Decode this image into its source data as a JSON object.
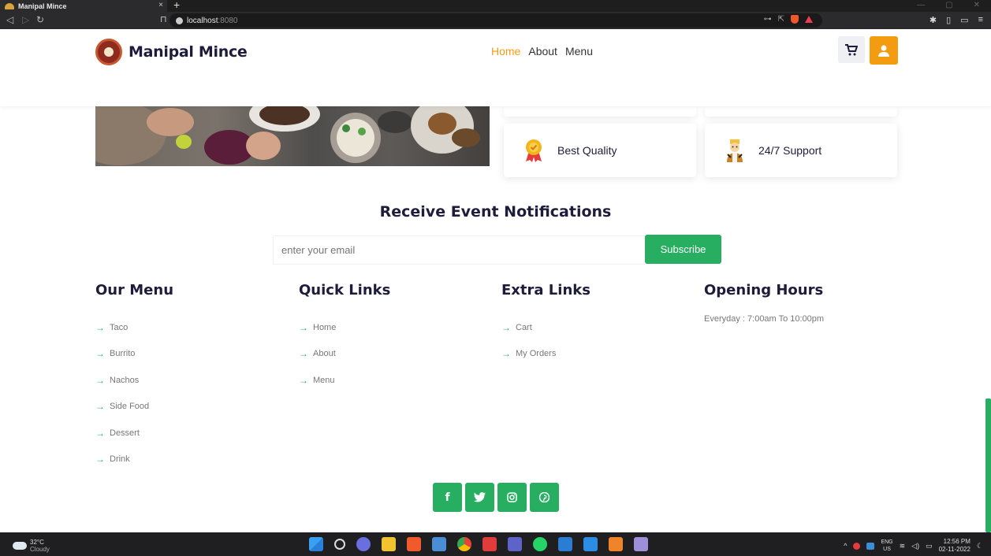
{
  "browser": {
    "tab_title": "Manipal Mince",
    "tab_close": "×",
    "new_tab": "+",
    "url_host": "localhost",
    "url_port": ":8080",
    "win_min": "—",
    "win_max": "▢",
    "win_close": "✕"
  },
  "header": {
    "logo_text": "Manipal Mince",
    "nav": [
      {
        "label": "Home"
      },
      {
        "label": "About"
      },
      {
        "label": "Menu"
      }
    ]
  },
  "features": [
    {
      "label": "Best Quality",
      "icon": "medal-icon"
    },
    {
      "label": "24/7 Support",
      "icon": "support-agent-icon"
    }
  ],
  "newsletter": {
    "title": "Receive Event Notifications",
    "placeholder": "enter your email",
    "button": "Subscribe"
  },
  "footer": {
    "menu": {
      "heading": "Our Menu",
      "items": [
        "Taco",
        "Burrito",
        "Nachos",
        "Side Food",
        "Dessert",
        "Drink"
      ]
    },
    "quick_links": {
      "heading": "Quick Links",
      "items": [
        "Home",
        "About",
        "Menu"
      ]
    },
    "extra_links": {
      "heading": "Extra Links",
      "items": [
        "Cart",
        "My Orders"
      ]
    },
    "opening_hours": {
      "heading": "Opening Hours",
      "text": "Everyday : 7:00am To 10:00pm"
    },
    "socials": [
      "facebook-icon",
      "twitter-icon",
      "instagram-icon",
      "pinterest-icon"
    ]
  },
  "taskbar": {
    "temperature": "32°C",
    "condition": "Cloudy",
    "lang_top": "ENG",
    "lang_bottom": "US",
    "time": "12:56 PM",
    "date": "02-11-2022"
  },
  "colors": {
    "accent_orange": "#f39c12",
    "accent_green": "#27ae60",
    "heading_navy": "#1d1c3a"
  }
}
